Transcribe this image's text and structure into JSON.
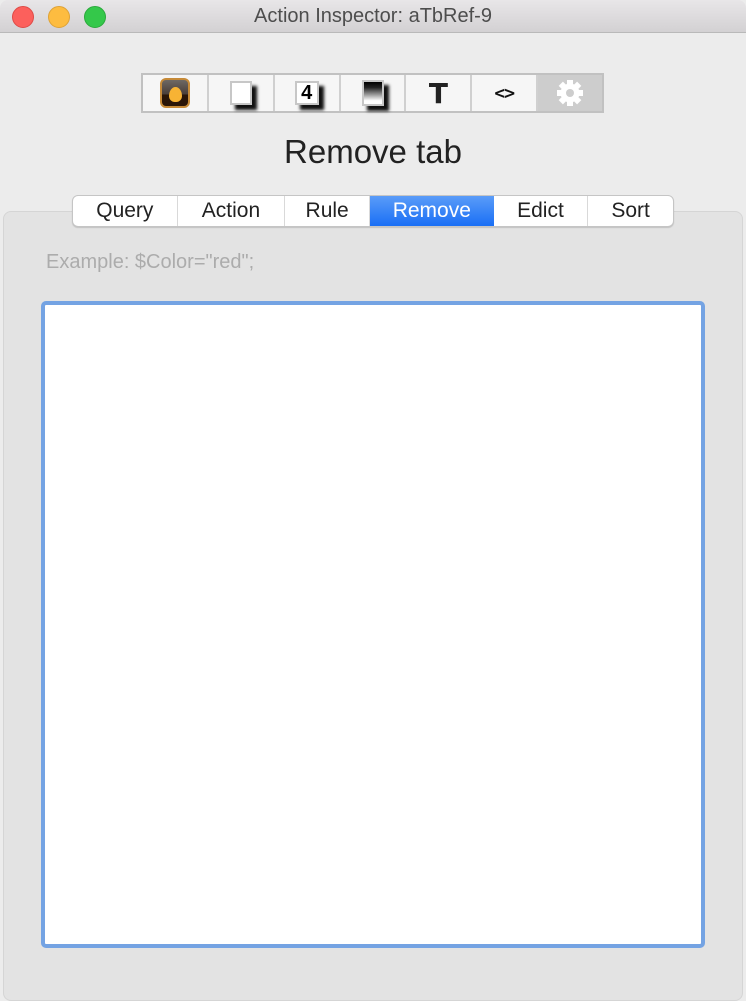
{
  "window": {
    "title": "Action Inspector: aTbRef-9",
    "controls": [
      "close",
      "minimize",
      "zoom"
    ]
  },
  "toolbar": {
    "segments": [
      {
        "icon": "flame-icon",
        "label": "Appearance",
        "selected": false
      },
      {
        "icon": "page-shadow-icon",
        "label": "Note",
        "selected": false
      },
      {
        "icon": "badge-4-icon",
        "label": "Badge",
        "selected": false
      },
      {
        "icon": "gradient-icon",
        "label": "Background",
        "selected": false
      },
      {
        "icon": "text-icon",
        "glyph": "T",
        "label": "Text",
        "selected": false
      },
      {
        "icon": "code-icon",
        "glyph": "<>",
        "label": "Code",
        "selected": false
      },
      {
        "icon": "gear-icon",
        "label": "Action",
        "selected": true
      }
    ]
  },
  "page": {
    "title": "Remove tab"
  },
  "tabs": [
    {
      "label": "Query",
      "selected": false
    },
    {
      "label": "Action",
      "selected": false
    },
    {
      "label": "Rule",
      "selected": false
    },
    {
      "label": "Remove",
      "selected": true
    },
    {
      "label": "Edict",
      "selected": false
    },
    {
      "label": "Sort",
      "selected": false
    }
  ],
  "panel": {
    "example_hint": "Example: $Color=\"red\";",
    "editor_value": ""
  },
  "colors": {
    "accent": "#1a6ff5",
    "focus_ring": "#74a3e3",
    "hint_text": "#acacac"
  }
}
